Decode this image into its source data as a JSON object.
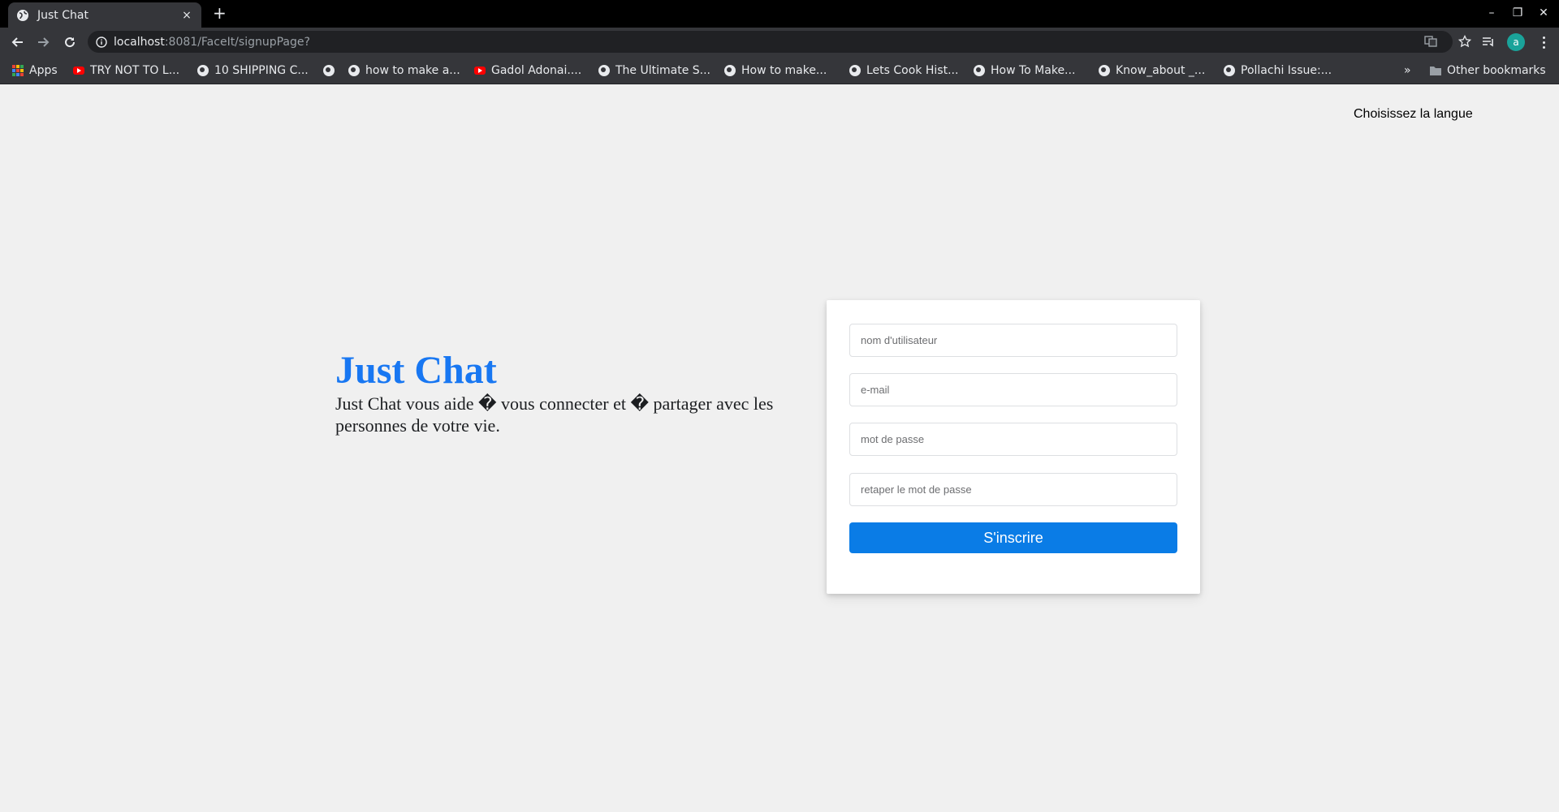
{
  "browser": {
    "tab": {
      "title": "Just Chat",
      "close": "×"
    },
    "new_tab": "+",
    "window_controls": {
      "minimize": "–",
      "restore": "❐",
      "close": "✕"
    },
    "address": {
      "host": "localhost",
      "path": ":8081/FaceIt/signupPage?"
    },
    "profile_initial": "a",
    "bookmarks": [
      {
        "label": "Apps",
        "icon": "apps-icon"
      },
      {
        "label": "TRY NOT TO L...",
        "icon": "youtube-icon"
      },
      {
        "label": "10 SHIPPING C...",
        "icon": "globe-icon"
      },
      {
        "label": "",
        "icon": "globe-icon"
      },
      {
        "label": "how to make a...",
        "icon": "globe-icon"
      },
      {
        "label": "Gadol Adonai....",
        "icon": "youtube-icon"
      },
      {
        "label": "The Ultimate S...",
        "icon": "globe-icon"
      },
      {
        "label": "How to make...",
        "icon": "globe-icon"
      },
      {
        "label": "Lets Cook Hist...",
        "icon": "globe-icon"
      },
      {
        "label": "How To Make...",
        "icon": "globe-icon"
      },
      {
        "label": "Know_about _...",
        "icon": "globe-icon"
      },
      {
        "label": "Pollachi Issue:...",
        "icon": "globe-icon"
      }
    ],
    "overflow": "»",
    "other_bookmarks": "Other bookmarks"
  },
  "page": {
    "language_link": "Choisissez la langue",
    "hero": {
      "title": "Just Chat",
      "subtitle": "Just Chat vous aide � vous connecter et � partager avec les personnes de votre vie."
    },
    "form": {
      "username_placeholder": "nom d'utilisateur",
      "email_placeholder": "e-mail",
      "password_placeholder": "mot de passe",
      "confirm_placeholder": "retaper le mot de passe",
      "submit_label": "S'inscrire"
    }
  },
  "colors": {
    "brand": "#1877f2",
    "button": "#0a7ce6",
    "page_bg": "#f0f0f0"
  }
}
